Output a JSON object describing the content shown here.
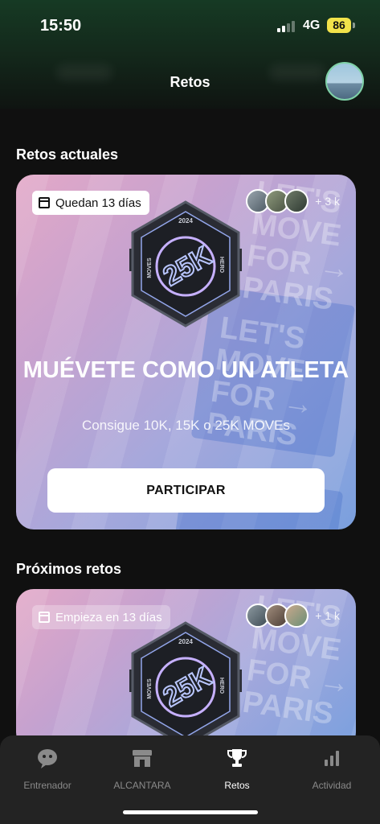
{
  "status_bar": {
    "time": "15:50",
    "network": "4G",
    "battery": "86"
  },
  "header": {
    "title": "Retos"
  },
  "current": {
    "section_title": "Retos actuales",
    "chip": "Quedan 13 días",
    "participants_count": "+ 3 k",
    "badge_year": "2024",
    "badge_main": "25K",
    "badge_left": "MOVES",
    "badge_right": "HERO",
    "bg_text": "LET'S MOVE FOR → PARIS",
    "title": "MUÉVETE COMO UN ATLETA",
    "subtitle": "Consigue  10K, 15K o 25K MOVEs",
    "button": "PARTICIPAR"
  },
  "upcoming": {
    "section_title": "Próximos retos",
    "chip": "Empieza en 13 días",
    "participants_count": "+ 1 k",
    "badge_year": "2024",
    "badge_main": "25K",
    "badge_left": "MOVES",
    "badge_right": "HERO",
    "bg_text": "LET'S MOVE FOR → PARIS"
  },
  "tabs": [
    {
      "label": "Entrenador",
      "icon": "coach-chat-icon"
    },
    {
      "label": "ALCANTARA",
      "icon": "store-icon"
    },
    {
      "label": "Retos",
      "icon": "trophy-icon"
    },
    {
      "label": "Actividad",
      "icon": "bar-chart-icon"
    }
  ],
  "active_tab": "Retos",
  "colors": {
    "accent_avatar_border": "#7fd1a7",
    "battery": "#f2e24a",
    "card_gradient_start": "#e3a8c7",
    "card_gradient_end": "#7aa0de"
  }
}
